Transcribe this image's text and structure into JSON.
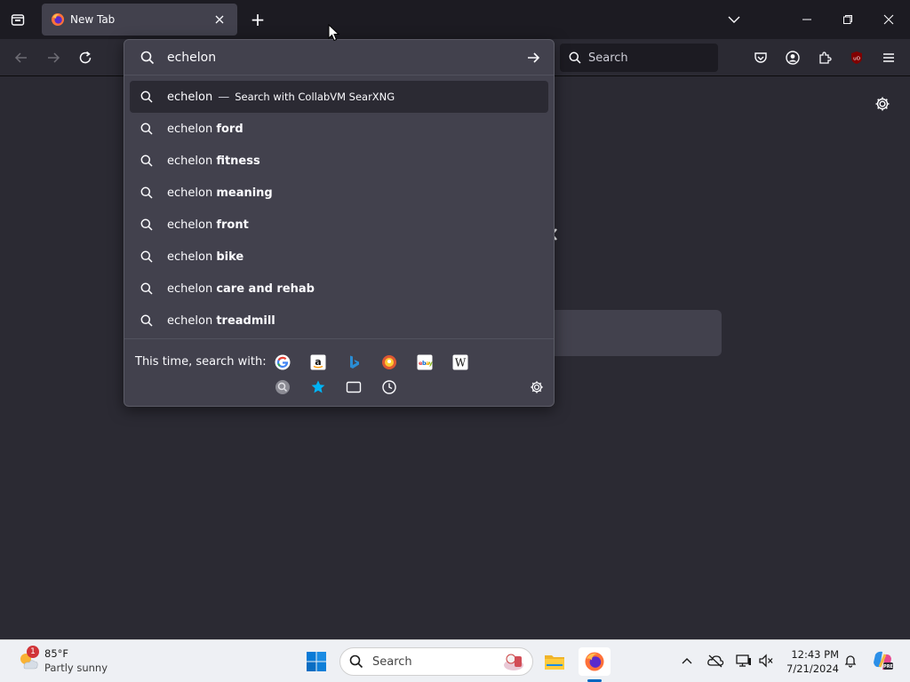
{
  "tabbar": {
    "tab_title": "New Tab",
    "new_tab_symbol": "+"
  },
  "navbar": {
    "search_placeholder": "Search"
  },
  "urlbar": {
    "typed_text": "echelon",
    "results": [
      {
        "prefix": "echelon",
        "suffix": "",
        "separator": "—",
        "action": "Search with CollabVM SearXNG",
        "selected": true
      },
      {
        "prefix": "echelon ",
        "suffix": "ford"
      },
      {
        "prefix": "echelon ",
        "suffix": "fitness"
      },
      {
        "prefix": "echelon ",
        "suffix": "meaning"
      },
      {
        "prefix": "echelon ",
        "suffix": "front"
      },
      {
        "prefix": "echelon ",
        "suffix": "bike"
      },
      {
        "prefix": "echelon ",
        "suffix": "care and rehab"
      },
      {
        "prefix": "echelon ",
        "suffix": "treadmill"
      }
    ],
    "oneoff_label": "This time, search with:",
    "engines": [
      "google-icon",
      "amazon-icon",
      "bing-icon",
      "duckduckgo-icon",
      "ebay-icon",
      "wikipedia-icon",
      "searxng-icon",
      "bookmarks-icon",
      "tabs-icon",
      "history-icon"
    ]
  },
  "taskbar": {
    "weather_temp": "85°F",
    "weather_desc": "Partly sunny",
    "weather_badge": "1",
    "search_label": "Search",
    "clock_time": "12:43 PM",
    "clock_date": "7/21/2024"
  },
  "colors": {
    "toolbar_bg": "#2b2a33",
    "tabbar_bg": "#1c1b22",
    "panel_bg": "#42414d",
    "taskbar_bg": "#eef0f4",
    "accent": "#0067c0"
  }
}
